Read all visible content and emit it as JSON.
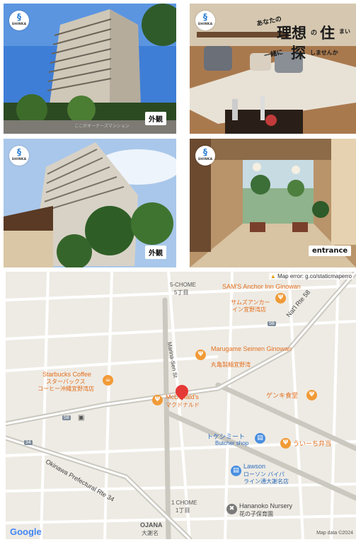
{
  "photos": {
    "logo_text": "SHINKA",
    "tile1": {
      "tag": "外観",
      "watermark": "ここがオーナーズマンション"
    },
    "tile2": {
      "line1a": "あなたの",
      "line1b": "理想",
      "line1c": "の",
      "line1d": "住",
      "line1e": "まい",
      "line2a": "一緒に",
      "line2b": "探",
      "line2c": "しませんか"
    },
    "tile3": {
      "tag": "外観"
    },
    "tile4": {
      "tag": "entrance"
    }
  },
  "map": {
    "error_text": "Map error: g.co/staticmaperro",
    "google_logo": "Google",
    "attribution": "Map data ©2024",
    "district_5chome": "5-CHOME",
    "district_5chome_jp": "5丁目",
    "district_1chome": "1 CHOME",
    "district_1chome_jp": "1丁目",
    "ojana": "OJANA",
    "ojana_jp": "大謝名",
    "road_natl58": "Nat'l Rte 58",
    "road_shield_58": "58",
    "road_shield_58b": "58",
    "road_shield_34": "34",
    "road_marina": "Marina-Sen St",
    "road_okinawa34": "Okinawa Prefectural Rte 34",
    "pois": [
      {
        "name": "SAM'S Anchor Inn Ginowan",
        "name2": "サムズアンカー",
        "name3": "イン宜野湾店"
      },
      {
        "name": "Marugame Seimen Ginowan",
        "name2": "丸亀製麺宜野湾"
      },
      {
        "name": "Starbucks Coffee",
        "name2": "スターバックス",
        "name3": "コーヒー沖縄宜野湾店"
      },
      {
        "name": "McDonald's",
        "name2": "マクドナルド"
      },
      {
        "name": "ゲンキ食堂"
      },
      {
        "name": "トケシミート",
        "name2": "Butcher shop"
      },
      {
        "name": "ういーち弁当"
      },
      {
        "name": "Lawson",
        "name2": "ローソン バイパ",
        "name3": "ライン通大謝名店"
      },
      {
        "name": "Hananoko Nursery",
        "name2": "花の子保育園"
      }
    ]
  }
}
